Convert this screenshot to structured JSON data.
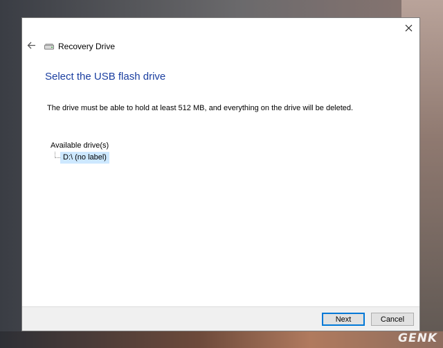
{
  "window": {
    "app_title": "Recovery Drive",
    "close_glyph": "✕"
  },
  "content": {
    "heading": "Select the USB flash drive",
    "description": "The drive must be able to hold at least 512 MB, and everything on the drive will be deleted.",
    "drives_label": "Available drive(s)",
    "drives": [
      {
        "label": "D:\\ (no label)",
        "selected": true
      }
    ]
  },
  "footer": {
    "next_label": "Next",
    "cancel_label": "Cancel"
  },
  "watermark": "GENK",
  "icons": {
    "back": "back-arrow-icon",
    "drive": "drive-icon",
    "close": "close-icon"
  },
  "colors": {
    "heading": "#1a3ea0",
    "selection": "#cde8ff",
    "primary_border": "#0078d7",
    "footer_bg": "#f0f0f0"
  }
}
